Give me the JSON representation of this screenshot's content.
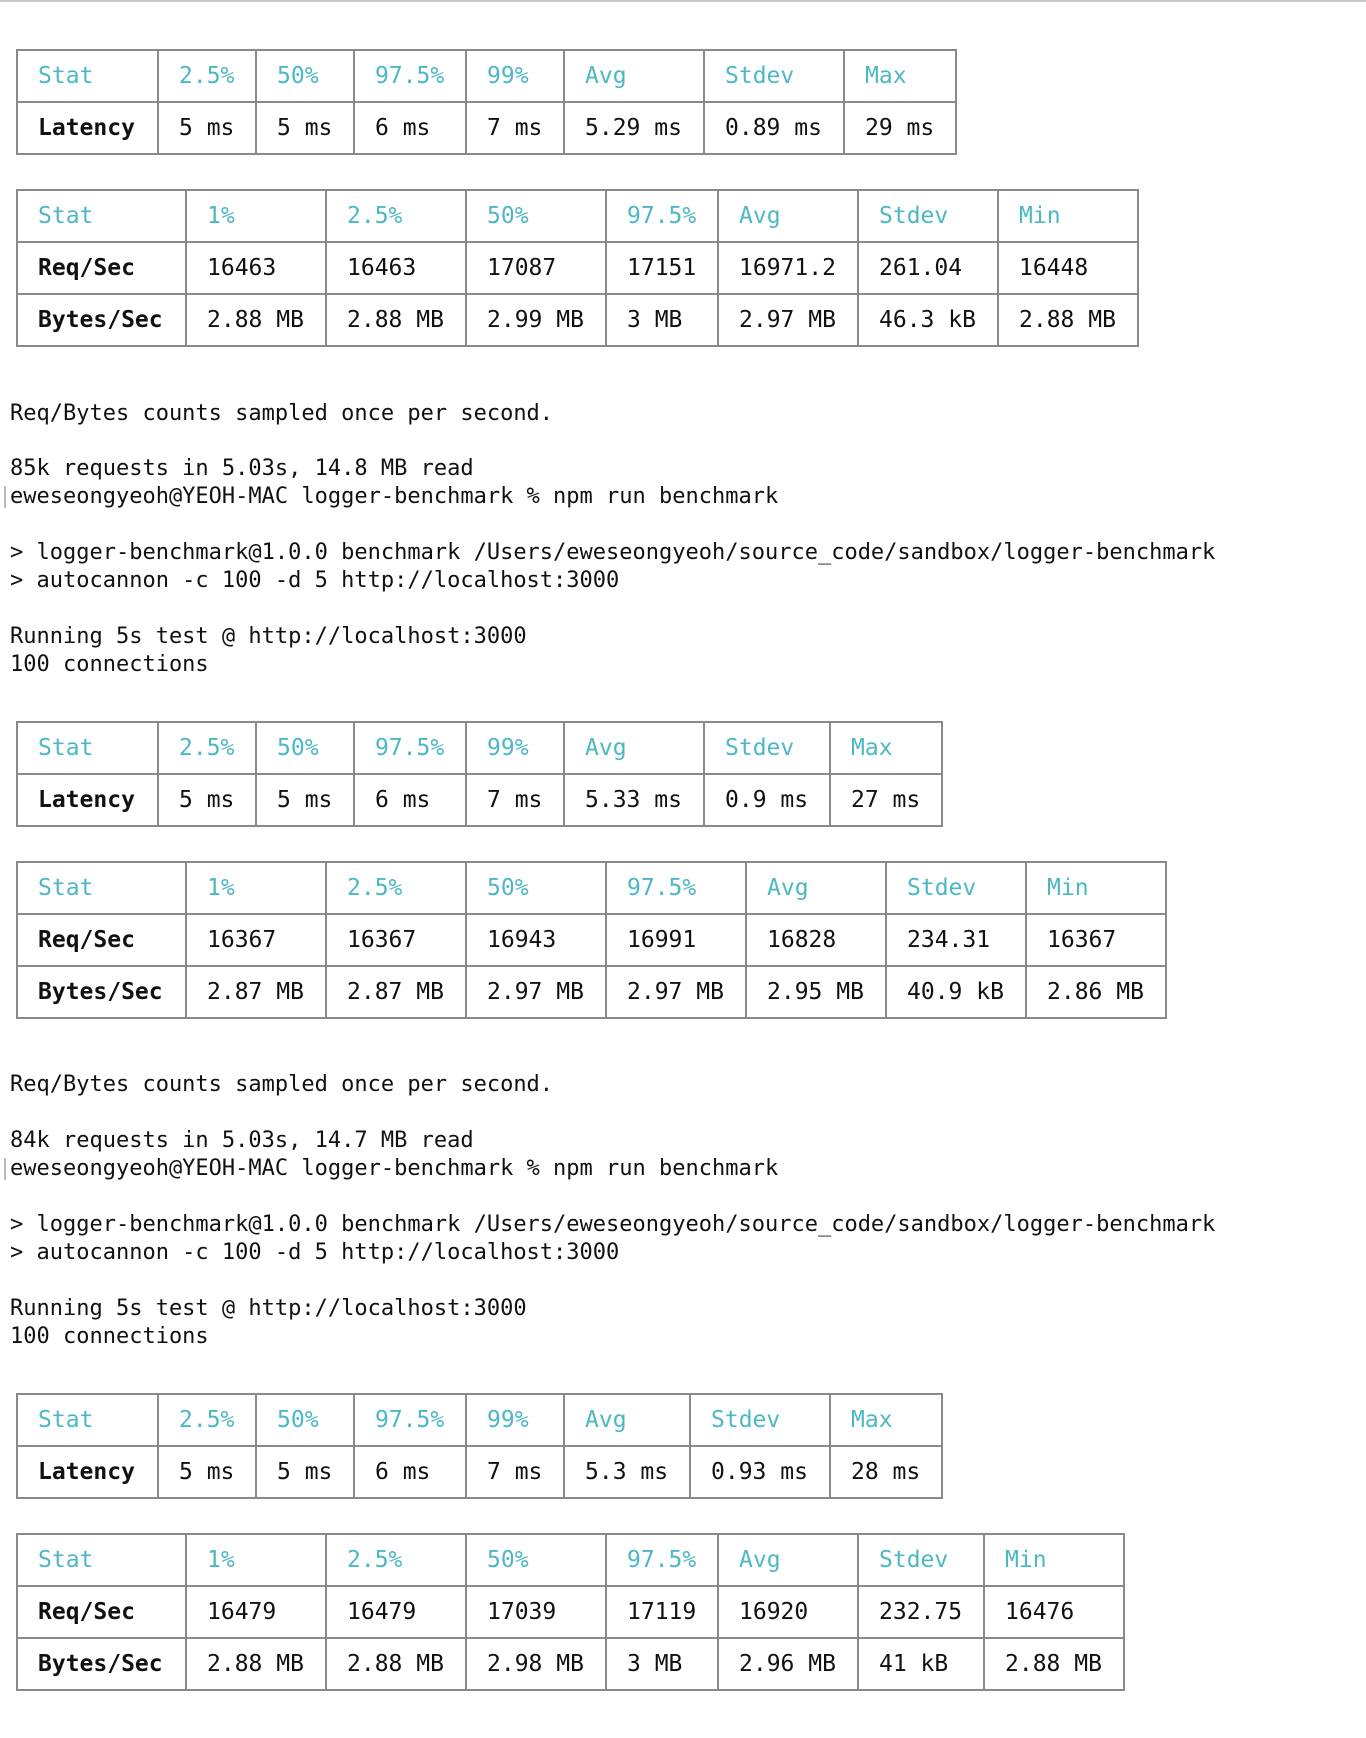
{
  "blocks": [
    {
      "latency": {
        "headers": [
          "Stat",
          "2.5%",
          "50%",
          "97.5%",
          "99%",
          "Avg",
          "Stdev",
          "Max"
        ],
        "row": [
          "Latency",
          "5 ms",
          "5 ms",
          "6 ms",
          "7 ms",
          "5.29 ms",
          "0.89 ms",
          "29 ms"
        ]
      },
      "throughput": {
        "headers": [
          "Stat",
          "1%",
          "2.5%",
          "50%",
          "97.5%",
          "Avg",
          "Stdev",
          "Min"
        ],
        "rows": [
          [
            "Req/Sec",
            "16463",
            "16463",
            "17087",
            "17151",
            "16971.2",
            "261.04",
            "16448"
          ],
          [
            "Bytes/Sec",
            "2.88 MB",
            "2.88 MB",
            "2.99 MB",
            "3 MB",
            "2.97 MB",
            "46.3 kB",
            "2.88 MB"
          ]
        ]
      },
      "sampled_note": "Req/Bytes counts sampled once per second.",
      "summary": "85k requests in 5.03s, 14.8 MB read",
      "prompt": "eweseongyeoh@YEOH-MAC logger-benchmark % npm run benchmark",
      "script_line_1": "> logger-benchmark@1.0.0 benchmark /Users/eweseongyeoh/source_code/sandbox/logger-benchmark",
      "script_line_2": "> autocannon -c 100 -d 5 http://localhost:3000",
      "running": "Running 5s test @ http://localhost:3000",
      "connections": "100 connections"
    },
    {
      "latency": {
        "headers": [
          "Stat",
          "2.5%",
          "50%",
          "97.5%",
          "99%",
          "Avg",
          "Stdev",
          "Max"
        ],
        "row": [
          "Latency",
          "5 ms",
          "5 ms",
          "6 ms",
          "7 ms",
          "5.33 ms",
          "0.9 ms",
          "27 ms"
        ]
      },
      "throughput": {
        "headers": [
          "Stat",
          "1%",
          "2.5%",
          "50%",
          "97.5%",
          "Avg",
          "Stdev",
          "Min"
        ],
        "rows": [
          [
            "Req/Sec",
            "16367",
            "16367",
            "16943",
            "16991",
            "16828",
            "234.31",
            "16367"
          ],
          [
            "Bytes/Sec",
            "2.87 MB",
            "2.87 MB",
            "2.97 MB",
            "2.97 MB",
            "2.95 MB",
            "40.9 kB",
            "2.86 MB"
          ]
        ]
      },
      "sampled_note": "Req/Bytes counts sampled once per second.",
      "summary": "84k requests in 5.03s, 14.7 MB read",
      "prompt": "eweseongyeoh@YEOH-MAC logger-benchmark % npm run benchmark",
      "script_line_1": "> logger-benchmark@1.0.0 benchmark /Users/eweseongyeoh/source_code/sandbox/logger-benchmark",
      "script_line_2": "> autocannon -c 100 -d 5 http://localhost:3000",
      "running": "Running 5s test @ http://localhost:3000",
      "connections": "100 connections"
    },
    {
      "latency": {
        "headers": [
          "Stat",
          "2.5%",
          "50%",
          "97.5%",
          "99%",
          "Avg",
          "Stdev",
          "Max"
        ],
        "row": [
          "Latency",
          "5 ms",
          "5 ms",
          "6 ms",
          "7 ms",
          "5.3 ms",
          "0.93 ms",
          "28 ms"
        ]
      },
      "throughput": {
        "headers": [
          "Stat",
          "1%",
          "2.5%",
          "50%",
          "97.5%",
          "Avg",
          "Stdev",
          "Min"
        ],
        "rows": [
          [
            "Req/Sec",
            "16479",
            "16479",
            "17039",
            "17119",
            "16920",
            "232.75",
            "16476"
          ],
          [
            "Bytes/Sec",
            "2.88 MB",
            "2.88 MB",
            "2.98 MB",
            "3 MB",
            "2.96 MB",
            "41 kB",
            "2.88 MB"
          ]
        ]
      }
    }
  ]
}
